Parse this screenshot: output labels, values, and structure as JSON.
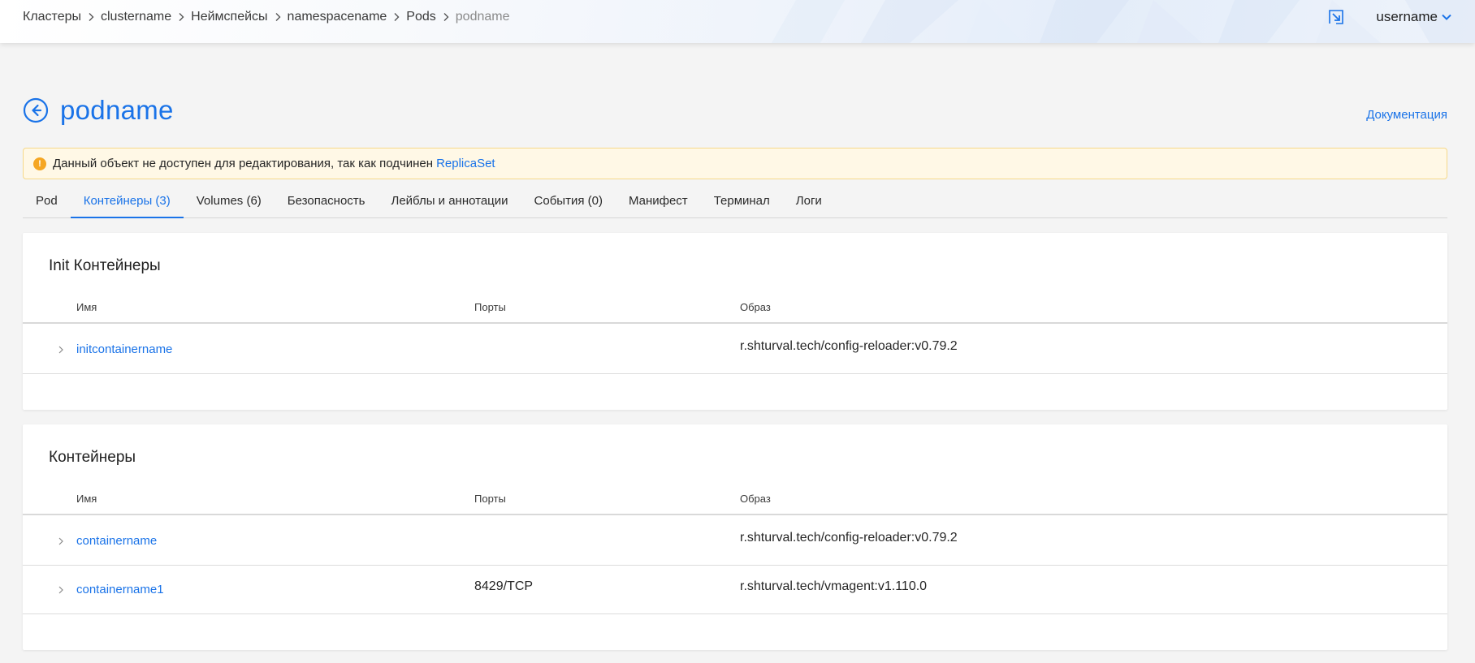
{
  "breadcrumb": {
    "items": [
      "Кластеры",
      "clustername",
      "Неймспейсы",
      "namespacename",
      "Pods"
    ],
    "current": "podname"
  },
  "user": {
    "name": "username"
  },
  "icons": {
    "external": "external-link-icon",
    "user_menu": "chevron-down-icon",
    "back": "arrow-left-circle-icon",
    "alert": "warning-icon",
    "expander": "chevron-right-icon",
    "separator": "chevron-right-icon"
  },
  "colors": {
    "accent": "#1a73e8",
    "warning_bg": "#fff8e6",
    "warning_border": "#f6d98a",
    "warning_icon": "#f5a623"
  },
  "page": {
    "title": "podname",
    "doc_link": "Документация"
  },
  "alert": {
    "icon_text": "!",
    "text": "Данный объект не доступен для редактирования, так как подчинен",
    "link": "ReplicaSet"
  },
  "tabs": [
    {
      "label": "Pod",
      "active": false
    },
    {
      "label": "Контейнеры (3)",
      "active": true
    },
    {
      "label": "Volumes (6)",
      "active": false
    },
    {
      "label": "Безопасность",
      "active": false
    },
    {
      "label": "Лейблы и аннотации",
      "active": false
    },
    {
      "label": "События (0)",
      "active": false
    },
    {
      "label": "Манифест",
      "active": false
    },
    {
      "label": "Терминал",
      "active": false
    },
    {
      "label": "Логи",
      "active": false
    }
  ],
  "init_containers": {
    "title": "Init Контейнеры",
    "columns": {
      "name": "Имя",
      "ports": "Порты",
      "image": "Образ"
    },
    "rows": [
      {
        "name": "initcontainername",
        "ports": "",
        "image": "r.shturval.tech/config-reloader:v0.79.2"
      }
    ]
  },
  "containers": {
    "title": "Контейнеры",
    "columns": {
      "name": "Имя",
      "ports": "Порты",
      "image": "Образ"
    },
    "rows": [
      {
        "name": "containername",
        "ports": "",
        "image": "r.shturval.tech/config-reloader:v0.79.2"
      },
      {
        "name": "containername1",
        "ports": "8429/TCP",
        "image": "r.shturval.tech/vmagent:v1.110.0"
      }
    ]
  }
}
